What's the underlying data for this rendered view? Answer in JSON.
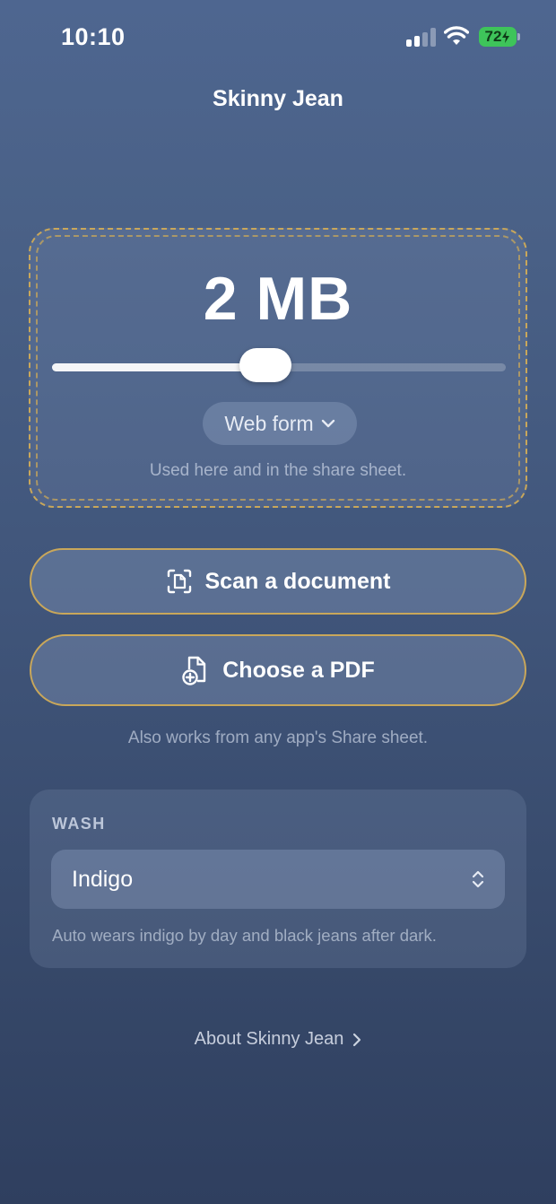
{
  "status_bar": {
    "time": "10:10",
    "battery": "72"
  },
  "nav": {
    "title": "Skinny Jean"
  },
  "size_card": {
    "value": "2 MB",
    "slider_level": 0.47,
    "format_label": "Web form",
    "caption": "Used here and in the share sheet."
  },
  "actions": {
    "scan_label": "Scan a document",
    "pdf_label": "Choose a PDF",
    "share_note": "Also works from any app's Share sheet."
  },
  "wash": {
    "label": "WASH",
    "selected": "Indigo",
    "caption": "Auto wears indigo by day and black jeans after dark."
  },
  "about": {
    "label": "About Skinny Jean"
  },
  "colors": {
    "accent_border": "#c9a75a",
    "battery_green": "#3ec45a",
    "background_top": "#4e6690",
    "background_bottom": "#2f3f5f"
  },
  "icons": [
    "cellular-signal-icon",
    "wifi-icon",
    "battery-icon",
    "scan-document-icon",
    "add-document-icon",
    "chevron-down-icon",
    "up-down-chevron-icon",
    "chevron-right-icon"
  ]
}
